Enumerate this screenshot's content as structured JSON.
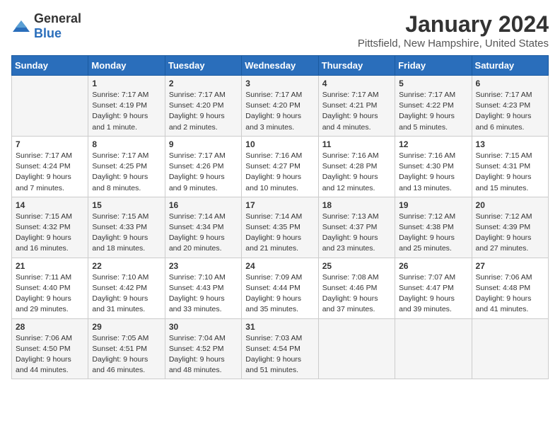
{
  "header": {
    "logo_general": "General",
    "logo_blue": "Blue",
    "title": "January 2024",
    "subtitle": "Pittsfield, New Hampshire, United States"
  },
  "days_of_week": [
    "Sunday",
    "Monday",
    "Tuesday",
    "Wednesday",
    "Thursday",
    "Friday",
    "Saturday"
  ],
  "weeks": [
    [
      {
        "day": "",
        "info": ""
      },
      {
        "day": "1",
        "info": "Sunrise: 7:17 AM\nSunset: 4:19 PM\nDaylight: 9 hours\nand 1 minute."
      },
      {
        "day": "2",
        "info": "Sunrise: 7:17 AM\nSunset: 4:20 PM\nDaylight: 9 hours\nand 2 minutes."
      },
      {
        "day": "3",
        "info": "Sunrise: 7:17 AM\nSunset: 4:20 PM\nDaylight: 9 hours\nand 3 minutes."
      },
      {
        "day": "4",
        "info": "Sunrise: 7:17 AM\nSunset: 4:21 PM\nDaylight: 9 hours\nand 4 minutes."
      },
      {
        "day": "5",
        "info": "Sunrise: 7:17 AM\nSunset: 4:22 PM\nDaylight: 9 hours\nand 5 minutes."
      },
      {
        "day": "6",
        "info": "Sunrise: 7:17 AM\nSunset: 4:23 PM\nDaylight: 9 hours\nand 6 minutes."
      }
    ],
    [
      {
        "day": "7",
        "info": "Sunrise: 7:17 AM\nSunset: 4:24 PM\nDaylight: 9 hours\nand 7 minutes."
      },
      {
        "day": "8",
        "info": "Sunrise: 7:17 AM\nSunset: 4:25 PM\nDaylight: 9 hours\nand 8 minutes."
      },
      {
        "day": "9",
        "info": "Sunrise: 7:17 AM\nSunset: 4:26 PM\nDaylight: 9 hours\nand 9 minutes."
      },
      {
        "day": "10",
        "info": "Sunrise: 7:16 AM\nSunset: 4:27 PM\nDaylight: 9 hours\nand 10 minutes."
      },
      {
        "day": "11",
        "info": "Sunrise: 7:16 AM\nSunset: 4:28 PM\nDaylight: 9 hours\nand 12 minutes."
      },
      {
        "day": "12",
        "info": "Sunrise: 7:16 AM\nSunset: 4:30 PM\nDaylight: 9 hours\nand 13 minutes."
      },
      {
        "day": "13",
        "info": "Sunrise: 7:15 AM\nSunset: 4:31 PM\nDaylight: 9 hours\nand 15 minutes."
      }
    ],
    [
      {
        "day": "14",
        "info": "Sunrise: 7:15 AM\nSunset: 4:32 PM\nDaylight: 9 hours\nand 16 minutes."
      },
      {
        "day": "15",
        "info": "Sunrise: 7:15 AM\nSunset: 4:33 PM\nDaylight: 9 hours\nand 18 minutes."
      },
      {
        "day": "16",
        "info": "Sunrise: 7:14 AM\nSunset: 4:34 PM\nDaylight: 9 hours\nand 20 minutes."
      },
      {
        "day": "17",
        "info": "Sunrise: 7:14 AM\nSunset: 4:35 PM\nDaylight: 9 hours\nand 21 minutes."
      },
      {
        "day": "18",
        "info": "Sunrise: 7:13 AM\nSunset: 4:37 PM\nDaylight: 9 hours\nand 23 minutes."
      },
      {
        "day": "19",
        "info": "Sunrise: 7:12 AM\nSunset: 4:38 PM\nDaylight: 9 hours\nand 25 minutes."
      },
      {
        "day": "20",
        "info": "Sunrise: 7:12 AM\nSunset: 4:39 PM\nDaylight: 9 hours\nand 27 minutes."
      }
    ],
    [
      {
        "day": "21",
        "info": "Sunrise: 7:11 AM\nSunset: 4:40 PM\nDaylight: 9 hours\nand 29 minutes."
      },
      {
        "day": "22",
        "info": "Sunrise: 7:10 AM\nSunset: 4:42 PM\nDaylight: 9 hours\nand 31 minutes."
      },
      {
        "day": "23",
        "info": "Sunrise: 7:10 AM\nSunset: 4:43 PM\nDaylight: 9 hours\nand 33 minutes."
      },
      {
        "day": "24",
        "info": "Sunrise: 7:09 AM\nSunset: 4:44 PM\nDaylight: 9 hours\nand 35 minutes."
      },
      {
        "day": "25",
        "info": "Sunrise: 7:08 AM\nSunset: 4:46 PM\nDaylight: 9 hours\nand 37 minutes."
      },
      {
        "day": "26",
        "info": "Sunrise: 7:07 AM\nSunset: 4:47 PM\nDaylight: 9 hours\nand 39 minutes."
      },
      {
        "day": "27",
        "info": "Sunrise: 7:06 AM\nSunset: 4:48 PM\nDaylight: 9 hours\nand 41 minutes."
      }
    ],
    [
      {
        "day": "28",
        "info": "Sunrise: 7:06 AM\nSunset: 4:50 PM\nDaylight: 9 hours\nand 44 minutes."
      },
      {
        "day": "29",
        "info": "Sunrise: 7:05 AM\nSunset: 4:51 PM\nDaylight: 9 hours\nand 46 minutes."
      },
      {
        "day": "30",
        "info": "Sunrise: 7:04 AM\nSunset: 4:52 PM\nDaylight: 9 hours\nand 48 minutes."
      },
      {
        "day": "31",
        "info": "Sunrise: 7:03 AM\nSunset: 4:54 PM\nDaylight: 9 hours\nand 51 minutes."
      },
      {
        "day": "",
        "info": ""
      },
      {
        "day": "",
        "info": ""
      },
      {
        "day": "",
        "info": ""
      }
    ]
  ]
}
